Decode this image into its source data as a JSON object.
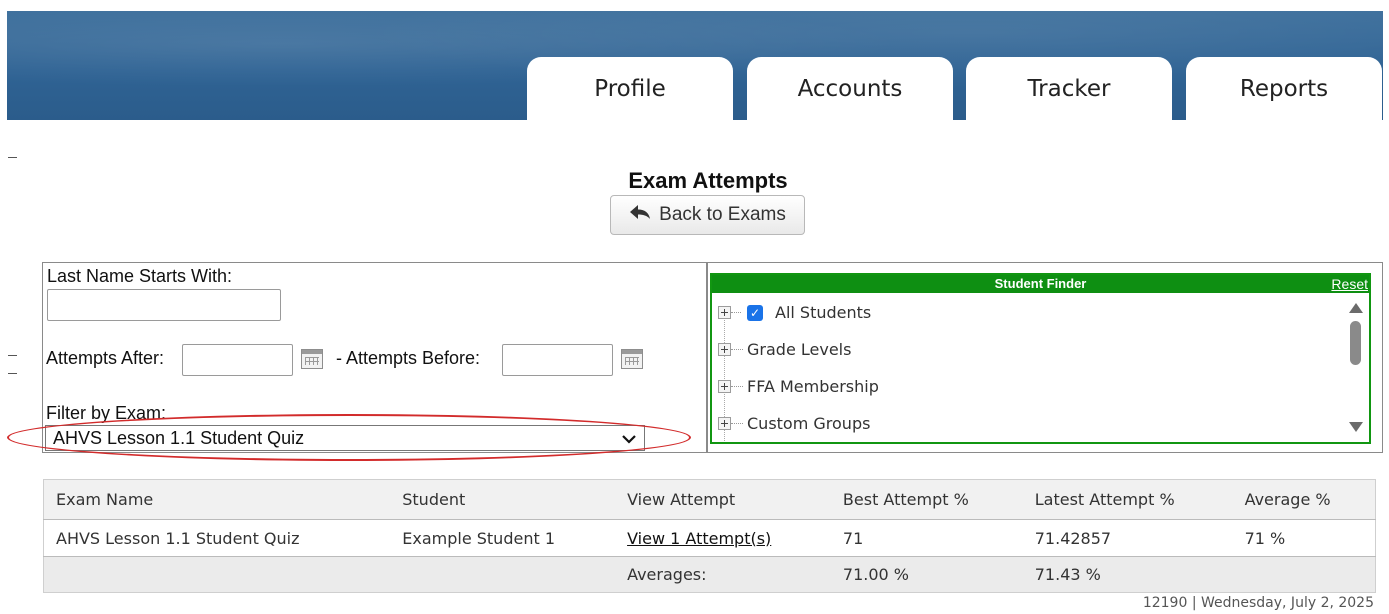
{
  "nav": {
    "tabs": [
      {
        "label": "Profile"
      },
      {
        "label": "Accounts"
      },
      {
        "label": "Tracker"
      },
      {
        "label": "Reports"
      }
    ]
  },
  "page": {
    "title": "Exam Attempts",
    "back_button_label": "Back to Exams",
    "back_icon": "arrow-back-icon"
  },
  "filters": {
    "last_name_label": "Last Name Starts With:",
    "last_name_value": "",
    "attempts_after_label": "Attempts After:",
    "attempts_after_value": "",
    "attempts_before_label": "- Attempts Before:",
    "attempts_before_value": "",
    "calendar_icon": "calendar-icon",
    "exam_label": "Filter by Exam:",
    "exam_selected": "AHVS Lesson 1.1 Student Quiz",
    "highlight_color": "#d22b2b"
  },
  "student_finder": {
    "title": "Student Finder",
    "reset_label": "Reset",
    "header_color": "#0e8f12",
    "items": [
      {
        "label": "All Students",
        "checked": true
      },
      {
        "label": "Grade Levels",
        "checked": false
      },
      {
        "label": "FFA Membership",
        "checked": false
      },
      {
        "label": "Custom Groups",
        "checked": false
      }
    ]
  },
  "results": {
    "columns": [
      "Exam Name",
      "Student",
      "View Attempt",
      "Best Attempt %",
      "Latest Attempt %",
      "Average %"
    ],
    "rows": [
      {
        "exam_name": "AHVS Lesson 1.1 Student Quiz",
        "student": "Example Student 1",
        "view_attempt": "View 1 Attempt(s)",
        "best": "71",
        "latest": "71.42857",
        "average": "71 %"
      }
    ],
    "averages": {
      "label": "Averages:",
      "best": "71.00 %",
      "latest": "71.43 %"
    }
  },
  "footer": {
    "text": "12190 | Wednesday, July 2, 2025"
  }
}
